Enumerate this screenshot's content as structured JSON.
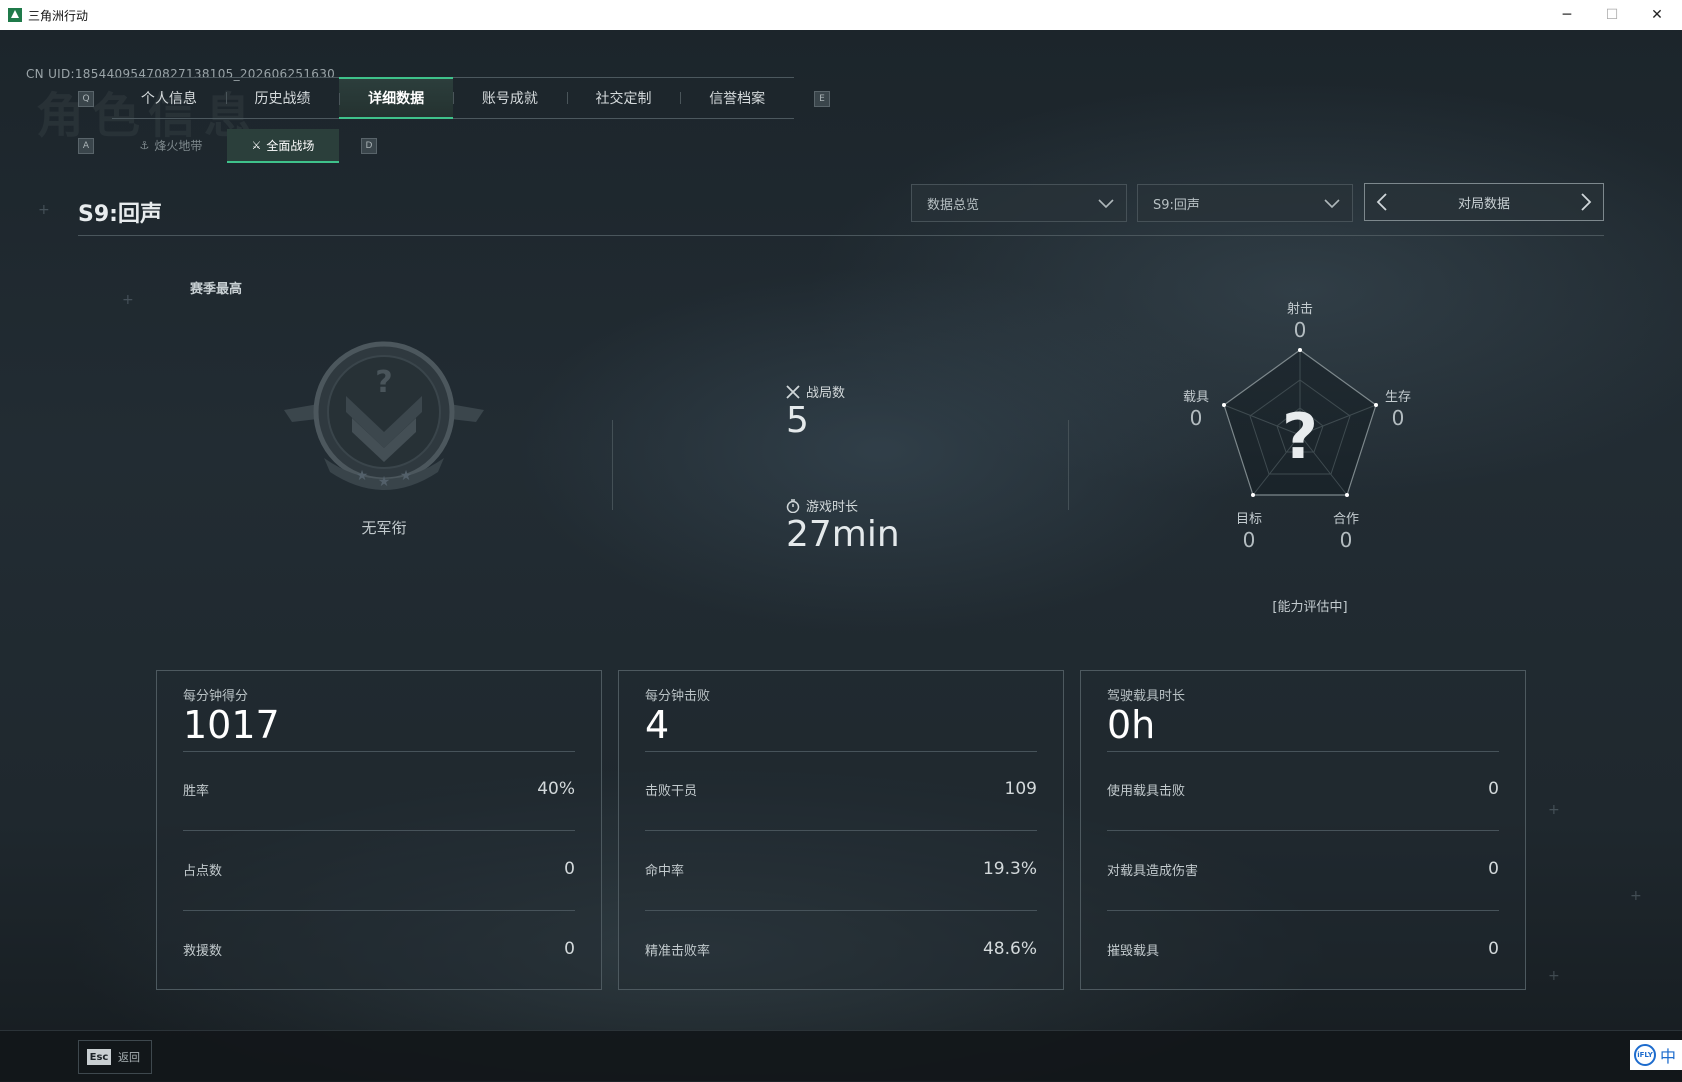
{
  "window": {
    "title": "三角洲行动",
    "controls": {
      "minimize": "─",
      "maximize": "☐",
      "close": "✕"
    }
  },
  "uid_text": "CN UID:18544095470827138105_202606251630",
  "page_watermark": "角色信息",
  "tab_keys": {
    "left": "Q",
    "right": "E"
  },
  "tabs": [
    {
      "label": "个人信息",
      "active": false
    },
    {
      "label": "历史战绩",
      "active": false
    },
    {
      "label": "详细数据",
      "active": true
    },
    {
      "label": "账号成就",
      "active": false
    },
    {
      "label": "社交定制",
      "active": false
    },
    {
      "label": "信誉档案",
      "active": false
    }
  ],
  "subtab_keys": {
    "left": "A",
    "right": "D"
  },
  "subtabs": [
    {
      "label": "烽火地带",
      "icon": "hazard-zone-icon",
      "active": false
    },
    {
      "label": "全面战场",
      "icon": "battlefield-icon",
      "active": true
    }
  ],
  "season_title": "S9:回声",
  "filters": {
    "overview": "数据总览",
    "season": "S9:回声",
    "pager_label": "对局数据"
  },
  "rank": {
    "section_label": "赛季最高",
    "name": "无军衔",
    "icon": "rank-badge-icon"
  },
  "match_stats": {
    "matches_label": "战局数",
    "matches_value": "5",
    "matches_icon": "crossed-swords-icon",
    "playtime_label": "游戏时长",
    "playtime_value": "27min",
    "playtime_icon": "stopwatch-icon"
  },
  "radar": {
    "center_mark": "?",
    "axes": [
      {
        "label": "射击",
        "value": 0
      },
      {
        "label": "生存",
        "value": 0
      },
      {
        "label": "合作",
        "value": 0
      },
      {
        "label": "目标",
        "value": 0
      },
      {
        "label": "载具",
        "value": 0
      }
    ],
    "status": "[能力评估中]"
  },
  "cards": [
    {
      "head_label": "每分钟得分",
      "head_value": "1017",
      "rows": [
        {
          "label": "胜率",
          "value": "40%"
        },
        {
          "label": "占点数",
          "value": "0"
        },
        {
          "label": "救援数",
          "value": "0"
        }
      ]
    },
    {
      "head_label": "每分钟击败",
      "head_value": "4",
      "rows": [
        {
          "label": "击败干员",
          "value": "109"
        },
        {
          "label": "命中率",
          "value": "19.3%"
        },
        {
          "label": "精准击败率",
          "value": "48.6%"
        }
      ]
    },
    {
      "head_label": "驾驶载具时长",
      "head_value": "0h",
      "rows": [
        {
          "label": "使用载具击败",
          "value": "0"
        },
        {
          "label": "对载具造成伤害",
          "value": "0"
        },
        {
          "label": "摧毁载具",
          "value": "0"
        }
      ]
    }
  ],
  "footer": {
    "esc_key": "Esc",
    "back_label": "返回",
    "ime_badge": "iFLY",
    "ime_mode": "中"
  },
  "colors": {
    "accent": "#3fc28b",
    "background": "#1b2329",
    "border": "#4d595f"
  }
}
